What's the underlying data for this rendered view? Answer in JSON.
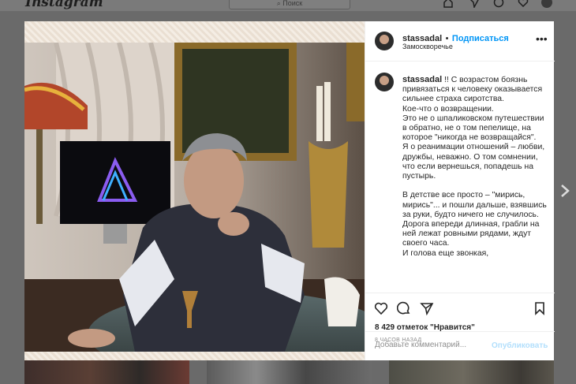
{
  "topbar": {
    "logo": "Instagram",
    "search_placeholder": "Поиск",
    "icons": [
      "home-icon",
      "direct-icon",
      "explore-icon",
      "heart-icon",
      "profile-avatar"
    ]
  },
  "post": {
    "username": "stassadal",
    "follow_label": "Подписаться",
    "separator": "•",
    "location": "Замоскворечье",
    "more_icon": "•••",
    "caption_author": "stassadal",
    "caption_body": " !! С возрастом боязнь привязаться к человеку оказывается сильнее страха сиротства.\nКое-что о возвращении.\nЭто не о шпаликовском путешествии в обратно, не о том пепелище, на которое \"никогда не возвращайся\".\nЯ о реанимации отношений – любви, дружбы, неважно. О том сомнении, что если вернешься, попадешь на пустырь.\n\nВ детстве все просто – \"мирись, мирись\"... и пошли дальше, взявшись за руки, будто ничего не случилось. Дорога впереди длинная, грабли на ней лежат ровными рядами, ждут своего часа.\nИ голова еще звонкая,",
    "likes": "8 429 отметок \"Нравится\"",
    "time_ago": "8 ЧАСОВ НАЗАД",
    "comment_placeholder": "Добавьте комментарий...",
    "publish_label": "Опубликовать"
  },
  "colors": {
    "accent": "#0095f6",
    "publish_disabled": "#b2dffc",
    "overlay": "#6a6a6a"
  }
}
